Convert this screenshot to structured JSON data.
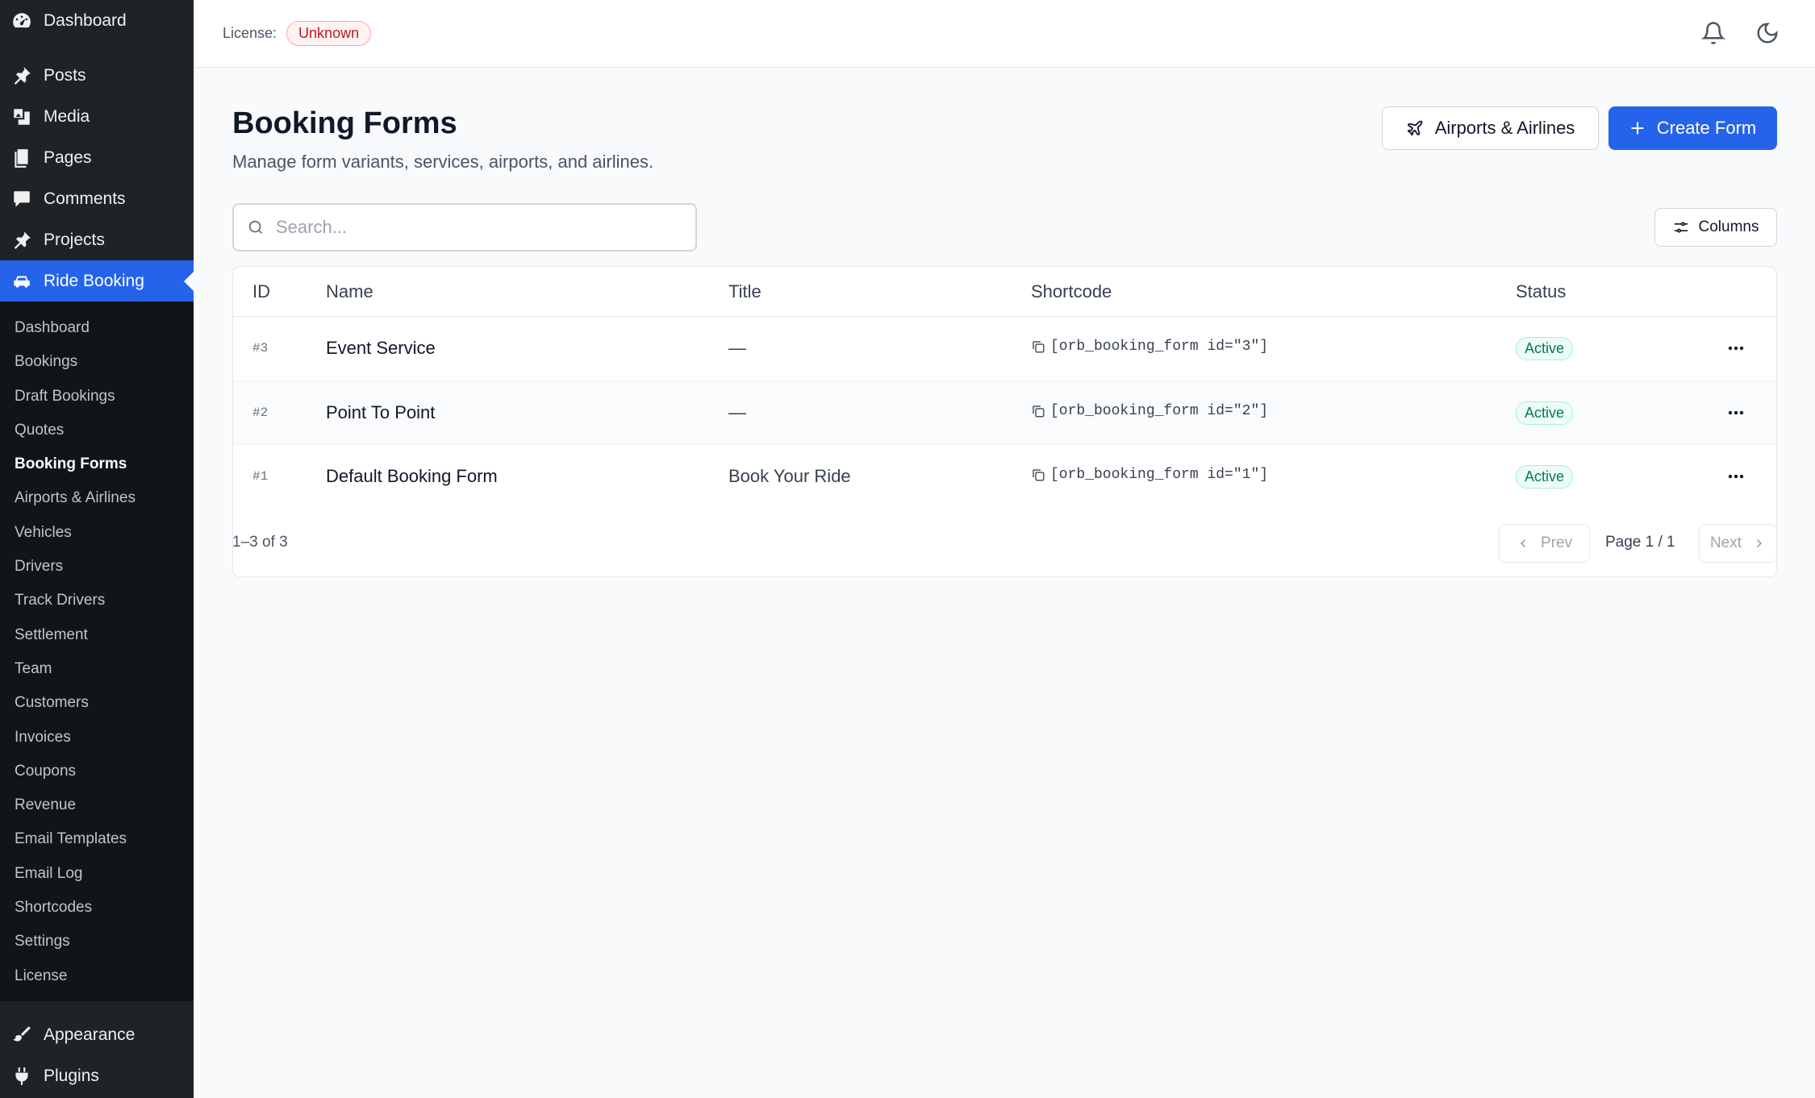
{
  "sidebar": {
    "top_items": [
      {
        "label": "Dashboard",
        "icon": "dashboard-icon"
      },
      {
        "label": "Posts",
        "icon": "pin-icon"
      },
      {
        "label": "Media",
        "icon": "media-icon"
      },
      {
        "label": "Pages",
        "icon": "pages-icon"
      },
      {
        "label": "Comments",
        "icon": "comment-icon"
      },
      {
        "label": "Projects",
        "icon": "pin-icon"
      },
      {
        "label": "Ride Booking",
        "icon": "car-icon"
      }
    ],
    "submenu": [
      "Dashboard",
      "Bookings",
      "Draft Bookings",
      "Quotes",
      "Booking Forms",
      "Airports & Airlines",
      "Vehicles",
      "Drivers",
      "Track Drivers",
      "Settlement",
      "Team",
      "Customers",
      "Invoices",
      "Coupons",
      "Revenue",
      "Email Templates",
      "Email Log",
      "Shortcodes",
      "Settings",
      "License"
    ],
    "bottom_items": [
      {
        "label": "Appearance",
        "icon": "brush-icon"
      },
      {
        "label": "Plugins",
        "icon": "plugin-icon"
      }
    ]
  },
  "topbar": {
    "license_label": "License:",
    "license_status": "Unknown"
  },
  "header": {
    "title": "Booking Forms",
    "subtitle": "Manage form variants, services, airports, and airlines.",
    "airports_button": "Airports & Airlines",
    "create_button": "Create Form"
  },
  "search": {
    "placeholder": "Search..."
  },
  "columns_button": "Columns",
  "table": {
    "headers": [
      "ID",
      "Name",
      "Title",
      "Shortcode",
      "Status"
    ],
    "rows": [
      {
        "id": "#3",
        "name": "Event Service",
        "title": "—",
        "shortcode": "[orb_booking_form id=\"3\"]",
        "status": "Active"
      },
      {
        "id": "#2",
        "name": "Point To Point",
        "title": "—",
        "shortcode": "[orb_booking_form id=\"2\"]",
        "status": "Active"
      },
      {
        "id": "#1",
        "name": "Default Booking Form",
        "title": "Book Your Ride",
        "shortcode": "[orb_booking_form id=\"1\"]",
        "status": "Active"
      }
    ]
  },
  "pagination": {
    "count": "1–3 of 3",
    "prev": "Prev",
    "page": "Page 1 / 1",
    "next": "Next"
  },
  "colors": {
    "accent": "#2563eb",
    "sidebar_bg": "#1d2327",
    "status_active": "#047857",
    "license_unknown": "#b91c1c"
  }
}
